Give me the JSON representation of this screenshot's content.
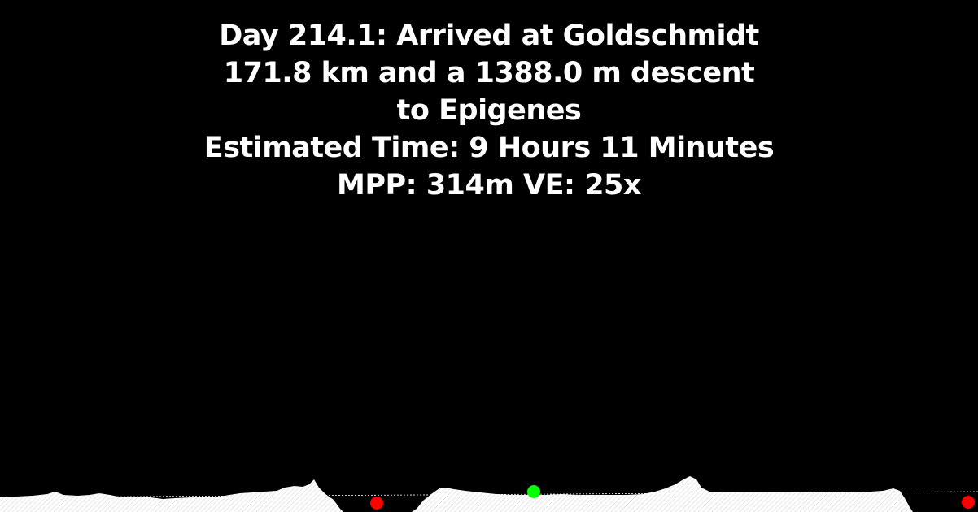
{
  "info": {
    "line1": "Day 214.1: Arrived at Goldschmidt",
    "line2": "171.8 km and a 1388.0 m descent",
    "line3": "to Epigenes",
    "line4": "Estimated Time: 9 Hours 11 Minutes",
    "line5": "MPP: 314m VE: 25x"
  },
  "colors": {
    "background": "#000000",
    "text": "#ffffff",
    "terrain": "#ffffff",
    "origin_marker": "#ff0000",
    "current_marker": "#00ff00",
    "destination_marker": "#ff0000"
  }
}
